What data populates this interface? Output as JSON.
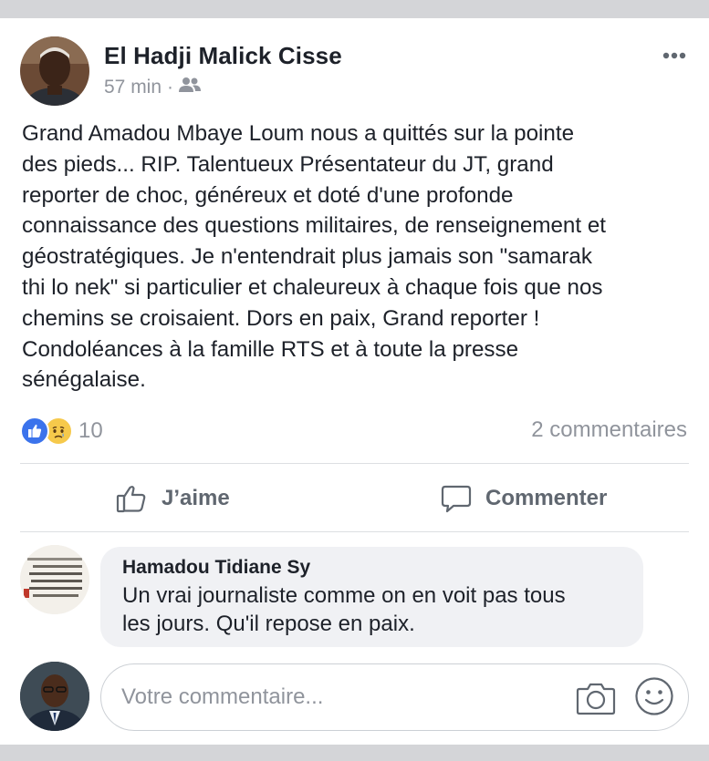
{
  "post": {
    "author": "El Hadji Malick Cisse",
    "time": "57 min",
    "separator": "·",
    "audience_icon": "friends-icon",
    "text": "Grand Amadou  Mbaye Loum  nous a quittés sur la pointe\ndes pieds... RIP. Talentueux Présentateur du JT,  grand\nreporter de choc, généreux et doté d'une profonde\nconnaissance des questions  militaires, de renseignement et\ngéostratégiques.  Je n'entendrait plus jamais son \"samarak\nthi lo nek\" si particulier et chaleureux à chaque fois que nos\nchemins se croisaient.  Dors en paix,  Grand reporter !\nCondoléances à la famille RTS et à toute la presse\nsénégalaise.",
    "reaction_count": "10",
    "comment_count": "2 commentaires"
  },
  "actions": {
    "like_label": "J’aime",
    "comment_label": "Commenter"
  },
  "comment": {
    "author": "Hamadou Tidiane Sy",
    "text": "Un vrai journaliste comme on en voit pas tous\nles jours. Qu'il repose en paix."
  },
  "composer": {
    "placeholder": "Votre commentaire...",
    "value": ""
  },
  "colors": {
    "like_blue": "#3b73ec",
    "sad_yellow": "#f6c94b",
    "muted_text": "#90949c",
    "action_text": "#606770",
    "bubble_bg": "#f0f1f4"
  }
}
